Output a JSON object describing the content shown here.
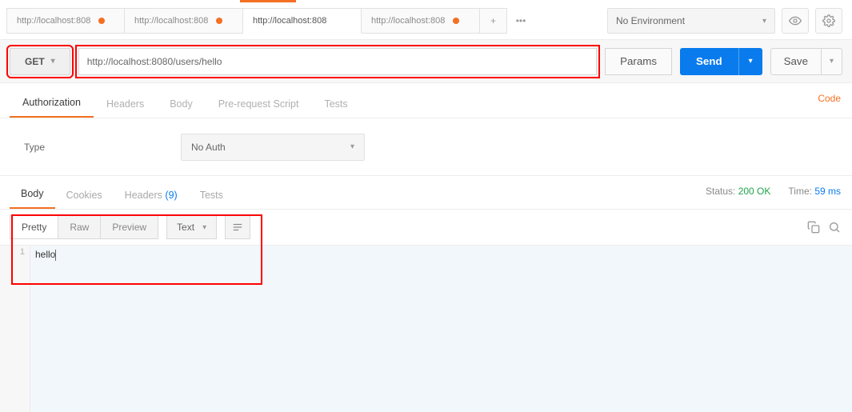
{
  "toolbar": {
    "tabs": [
      {
        "label": "http://localhost:808",
        "dirty": true
      },
      {
        "label": "http://localhost:808",
        "dirty": true
      },
      {
        "label": "http://localhost:808",
        "dirty": false,
        "active": true
      },
      {
        "label": "http://localhost:808",
        "dirty": true
      }
    ],
    "add_label": "+",
    "more_label": "•••",
    "environment": "No Environment"
  },
  "request": {
    "method": "GET",
    "url": "http://localhost:8080/users/hello",
    "params_label": "Params",
    "send_label": "Send",
    "save_label": "Save"
  },
  "req_tabs": {
    "authorization": "Authorization",
    "headers": "Headers",
    "body": "Body",
    "prerequest": "Pre-request Script",
    "tests": "Tests",
    "code": "Code"
  },
  "auth": {
    "type_label": "Type",
    "selected": "No Auth"
  },
  "resp_tabs": {
    "body": "Body",
    "cookies": "Cookies",
    "headers": "Headers",
    "headers_count": "(9)",
    "tests": "Tests"
  },
  "status": {
    "status_label": "Status:",
    "status_value": "200 OK",
    "time_label": "Time:",
    "time_value": "59 ms"
  },
  "format": {
    "pretty": "Pretty",
    "raw": "Raw",
    "preview": "Preview",
    "mode": "Text"
  },
  "response": {
    "line_number": "1",
    "body": "hello"
  }
}
